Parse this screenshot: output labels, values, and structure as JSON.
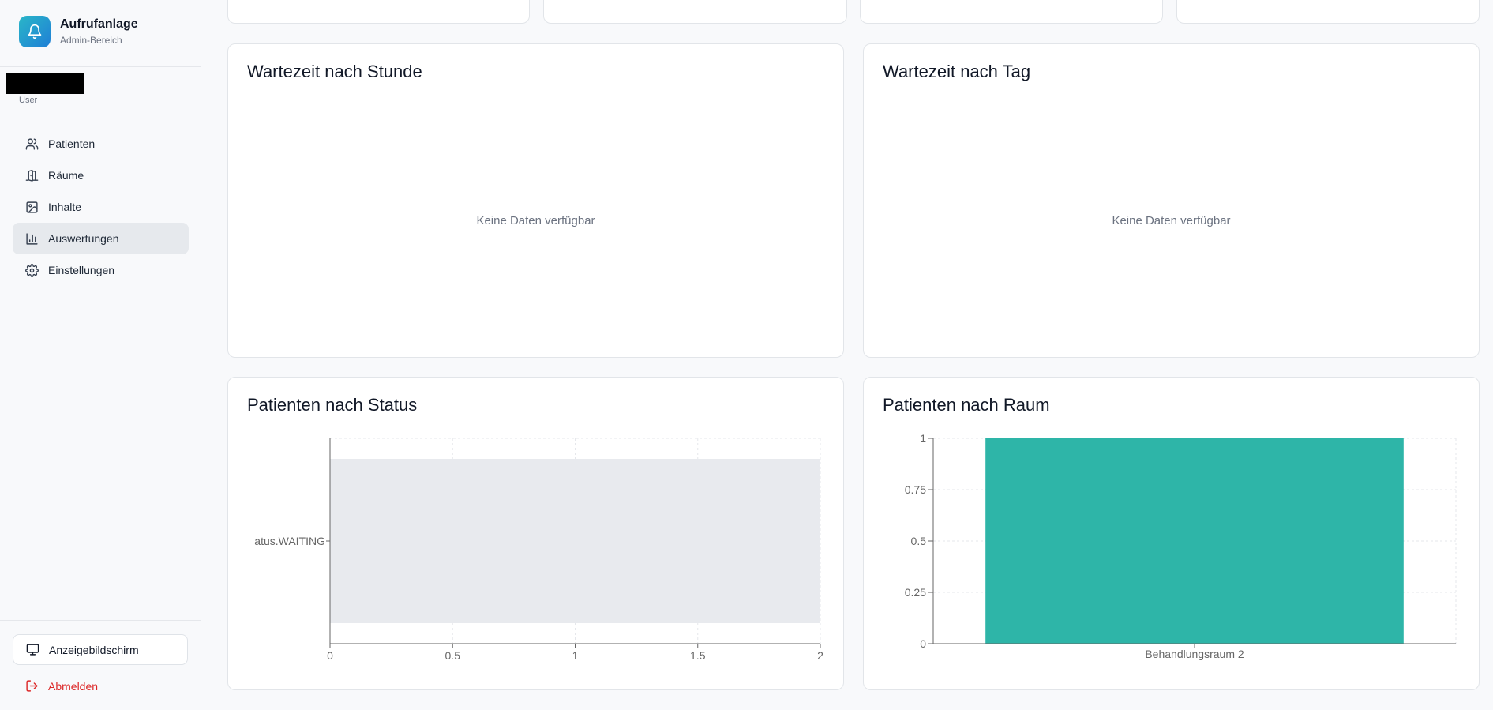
{
  "app": {
    "title": "Aufrufanlage",
    "subtitle": "Admin-Bereich"
  },
  "user": {
    "role": "User"
  },
  "nav": [
    {
      "label": "Patienten",
      "icon": "users-icon"
    },
    {
      "label": "Räume",
      "icon": "door-icon"
    },
    {
      "label": "Inhalte",
      "icon": "image-icon"
    },
    {
      "label": "Auswertungen",
      "icon": "bar-chart-icon",
      "active": true
    },
    {
      "label": "Einstellungen",
      "icon": "gear-icon"
    }
  ],
  "footer": {
    "display_button": "Anzeigebildschirm",
    "logout": "Abmelden"
  },
  "cards": {
    "wait_hour": {
      "title": "Wartezeit nach Stunde",
      "empty": "Keine Daten verfügbar"
    },
    "wait_day": {
      "title": "Wartezeit nach Tag",
      "empty": "Keine Daten verfügbar"
    },
    "status": {
      "title": "Patienten nach Status"
    },
    "room": {
      "title": "Patienten nach Raum"
    }
  },
  "colors": {
    "accent": "#2eb5a8",
    "status_bar": "#e8eaee",
    "logout": "#dc2626"
  },
  "chart_data": [
    {
      "type": "bar",
      "orientation": "horizontal",
      "title": "Patienten nach Status",
      "categories": [
        "atus.WAITING"
      ],
      "values": [
        2
      ],
      "xlim": [
        0,
        2
      ],
      "xticks": [
        "0",
        "0.5",
        "1",
        "1.5",
        "2"
      ],
      "grid": true
    },
    {
      "type": "bar",
      "title": "Patienten nach Raum",
      "categories": [
        "Behandlungsraum 2"
      ],
      "values": [
        1
      ],
      "ylim": [
        0,
        1
      ],
      "yticks": [
        "0",
        "0.25",
        "0.5",
        "0.75",
        "1"
      ],
      "grid": true
    }
  ]
}
